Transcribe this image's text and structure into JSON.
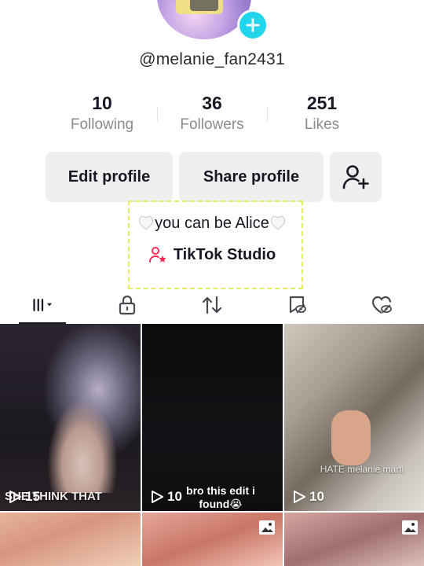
{
  "profile": {
    "username": "@melanie_fan2431",
    "bio": "you can be Alice",
    "studio_link": "TikTok Studio"
  },
  "stats": [
    {
      "value": "10",
      "label": "Following"
    },
    {
      "value": "36",
      "label": "Followers"
    },
    {
      "value": "251",
      "label": "Likes"
    }
  ],
  "buttons": {
    "edit": "Edit profile",
    "share": "Share profile"
  },
  "tabs": [
    {
      "name": "videos-grid-icon",
      "active": true
    },
    {
      "name": "lock-icon",
      "active": false
    },
    {
      "name": "repost-icon",
      "active": false
    },
    {
      "name": "bookmark-hidden-icon",
      "active": false
    },
    {
      "name": "liked-hidden-icon",
      "active": false
    }
  ],
  "videos": [
    {
      "views": "15",
      "caption": "SHE THINK THAT"
    },
    {
      "views": "10",
      "caption": "bro this edit i found😭"
    },
    {
      "views": "10",
      "caption": "HATE melanie marti"
    }
  ],
  "colors": {
    "accent_cyan": "#20d5ec",
    "studio_pink": "#fe2c55",
    "button_bg": "#efefef"
  }
}
